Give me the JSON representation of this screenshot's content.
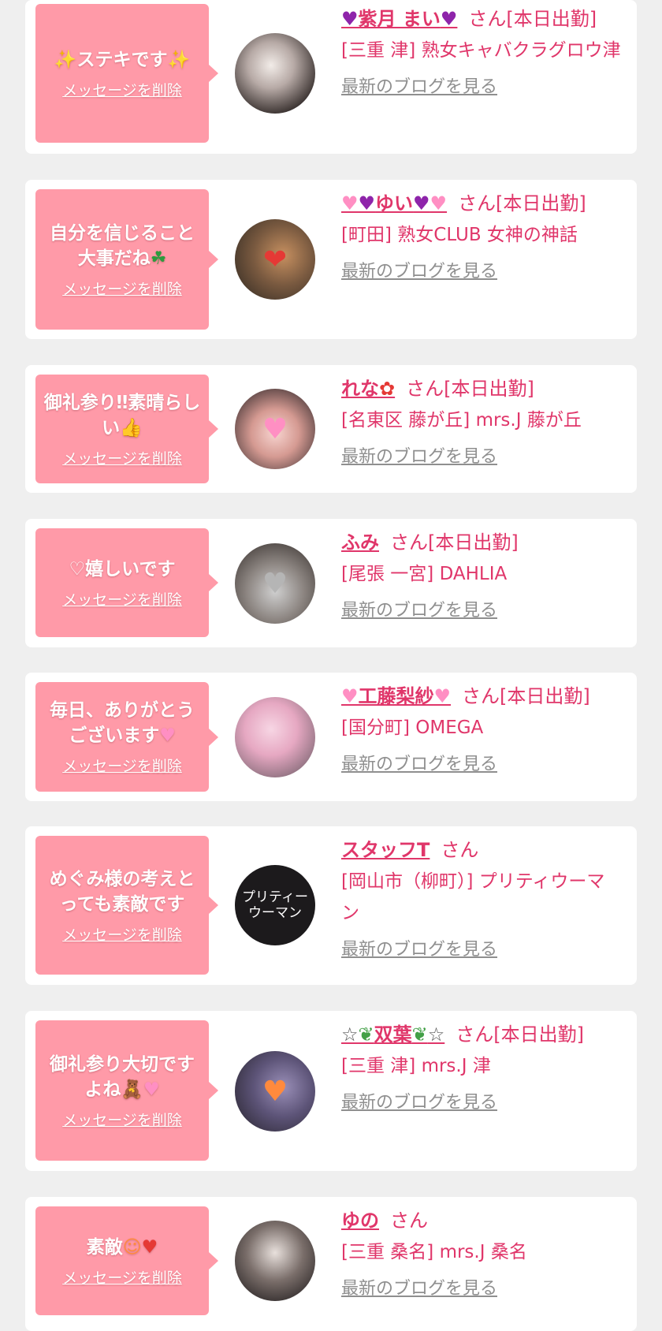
{
  "common": {
    "delete_label": "メッセージを削除",
    "blog_label": "最新のブログを見る"
  },
  "items": [
    {
      "message": "ステキです",
      "name": "紫月 まい",
      "suffix": "さん[本日出勤]",
      "shop": "[三重 津] 熟女キャバクラグロウ津"
    },
    {
      "message": "自分を信じること\n大事だね",
      "name": "ゆい",
      "suffix": "さん[本日出勤]",
      "shop": "[町田] 熟女CLUB 女神の神話"
    },
    {
      "message": "御礼参り‼素晴らしい",
      "name": "れな",
      "suffix": "さん[本日出勤]",
      "shop": "[名東区 藤が丘] mrs.J 藤が丘"
    },
    {
      "message": "♡嬉しいです",
      "name": "ふみ",
      "suffix": "さん[本日出勤]",
      "shop": "[尾張 一宮] DAHLIA"
    },
    {
      "message": "毎日、ありがとう\nございます",
      "name": "工藤梨紗",
      "suffix": "さん[本日出勤]",
      "shop": "[国分町] OMEGA"
    },
    {
      "message": "めぐみ様の考えと\nっても素敵です",
      "name": "スタッフT",
      "suffix": "さん",
      "shop": "[岡山市（柳町）] プリティウーマン",
      "avatar_text": "プリティーウーマン"
    },
    {
      "message": "御礼参り大切です\nよね",
      "name": "双葉",
      "suffix": "さん[本日出勤]",
      "shop": "[三重 津] mrs.J 津"
    },
    {
      "message": "素敵",
      "name": "ゆの",
      "suffix": "さん",
      "shop": "[三重 桑名] mrs.J 桑名"
    }
  ]
}
